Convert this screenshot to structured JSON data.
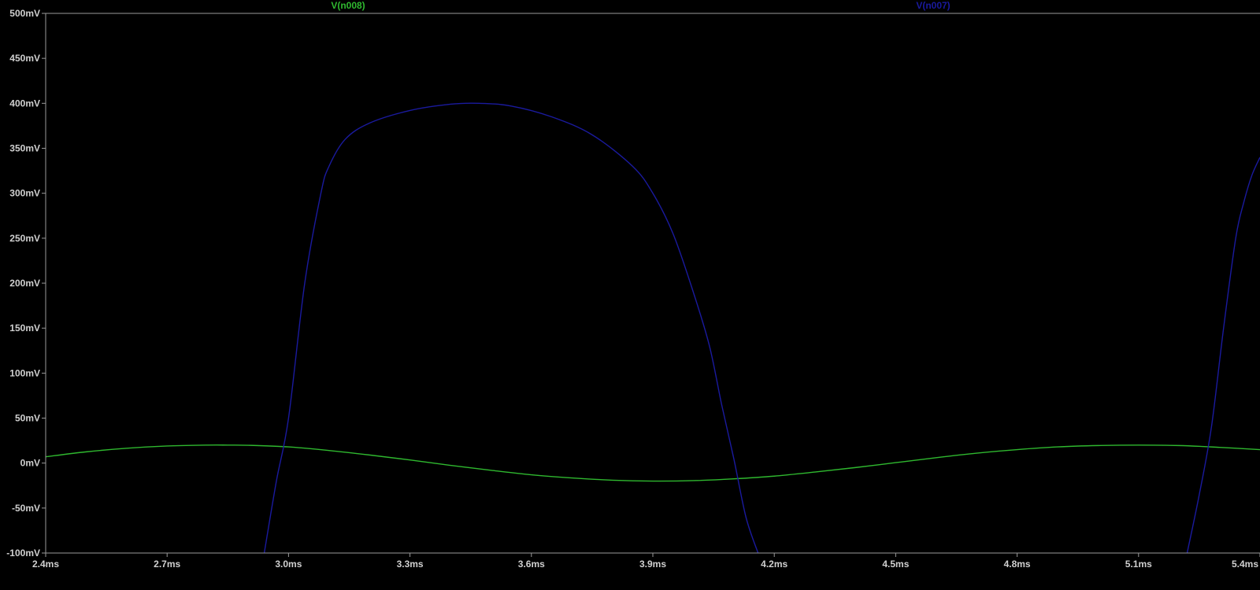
{
  "colors": {
    "background": "#000000",
    "axis": "#9a9a9a",
    "tick_text": "#d0d0d0",
    "series_v008": "#2fb82f",
    "series_v007": "#1a1a9e"
  },
  "chart_data": {
    "type": "line",
    "title": "",
    "xlabel": "",
    "ylabel": "",
    "x_unit": "ms",
    "y_unit": "mV",
    "xlim": [
      2.4,
      5.4
    ],
    "ylim": [
      -100,
      500
    ],
    "grid": false,
    "legend": "top",
    "x_ticks": [
      "2.4ms",
      "2.7ms",
      "3.0ms",
      "3.3ms",
      "3.6ms",
      "3.9ms",
      "4.2ms",
      "4.5ms",
      "4.8ms",
      "5.1ms",
      "5.4ms"
    ],
    "y_ticks": [
      "500mV",
      "450mV",
      "400mV",
      "350mV",
      "300mV",
      "250mV",
      "200mV",
      "150mV",
      "100mV",
      "50mV",
      "0mV",
      "-50mV",
      "-100mV"
    ],
    "series": [
      {
        "name": "V(n008)",
        "color": "#2fb82f",
        "x": [
          2.4,
          2.5,
          2.6,
          2.7,
          2.8,
          2.85,
          2.9,
          3.0,
          3.1,
          3.2,
          3.3,
          3.4,
          3.5,
          3.6,
          3.7,
          3.8,
          3.9,
          4.0,
          4.1,
          4.2,
          4.3,
          4.4,
          4.5,
          4.6,
          4.7,
          4.8,
          4.9,
          5.0,
          5.1,
          5.2,
          5.3,
          5.4
        ],
        "y": [
          7,
          12.5,
          16.5,
          19,
          20,
          20,
          19.8,
          18,
          14,
          9,
          3.5,
          -2.5,
          -8,
          -13,
          -16.5,
          -19,
          -20,
          -19.5,
          -17.5,
          -14.5,
          -10,
          -5,
          0.5,
          6,
          11,
          15,
          18,
          19.5,
          20,
          19.5,
          17.5,
          15
        ]
      },
      {
        "name": "V(n007)",
        "color": "#1a1a9e",
        "x": [
          2.94,
          2.97,
          3.0,
          3.04,
          3.08,
          3.1,
          3.14,
          3.2,
          3.3,
          3.4,
          3.47,
          3.55,
          3.65,
          3.75,
          3.85,
          3.9,
          3.95,
          4.0,
          4.04,
          4.07,
          4.1,
          4.13,
          4.16,
          4.1,
          4.13
        ],
        "y": [
          -100,
          -20,
          50,
          200,
          300,
          330,
          360,
          378,
          392,
          399,
          400,
          397,
          385,
          365,
          330,
          300,
          255,
          190,
          130,
          65,
          -15,
          -100,
          -100,
          -15,
          -100
        ],
        "segments": [
          {
            "x": [
              2.94,
              2.97,
              3.0,
              3.04,
              3.08,
              3.1,
              3.14,
              3.2,
              3.3,
              3.4,
              3.47,
              3.55,
              3.65,
              3.75,
              3.85,
              3.9,
              3.95,
              4.0,
              4.04,
              4.07,
              4.1,
              4.13,
              4.16
            ],
            "y": [
              -100,
              -20,
              50,
              200,
              300,
              330,
              360,
              378,
              392,
              399,
              400,
              397,
              385,
              365,
              330,
              300,
              255,
              190,
              130,
              65,
              5,
              -60,
              -100
            ]
          },
          {
            "x": [
              5.22,
              5.25,
              5.28,
              5.31,
              5.34,
              5.36,
              5.38,
              5.4
            ],
            "y": [
              -100,
              -35,
              40,
              150,
              250,
              290,
              320,
              340
            ]
          }
        ]
      }
    ]
  }
}
